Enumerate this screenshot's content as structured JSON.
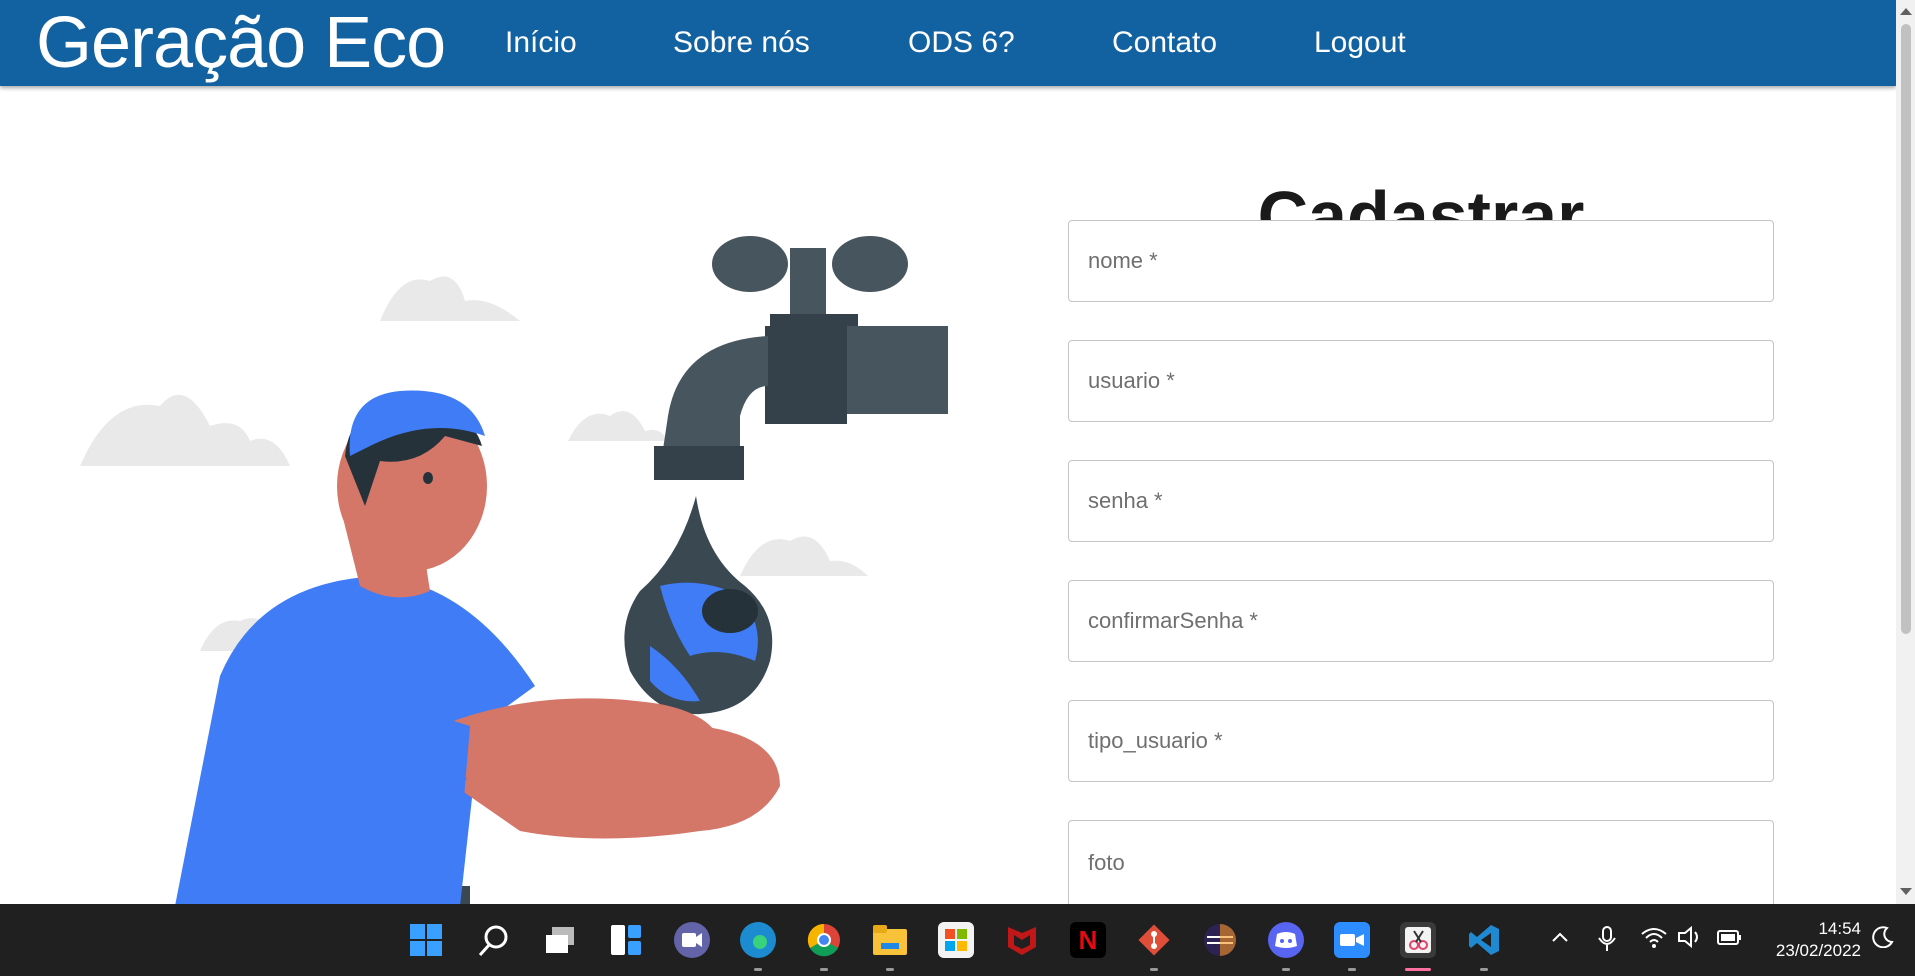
{
  "navbar": {
    "brand": "Geração Eco",
    "links": [
      "Início",
      "Sobre nós",
      "ODS 6?",
      "Contato",
      "Logout"
    ]
  },
  "form": {
    "title": "Cadastrar",
    "fields": [
      {
        "placeholder": "nome *",
        "value": ""
      },
      {
        "placeholder": "usuario *",
        "value": ""
      },
      {
        "placeholder": "senha *",
        "value": ""
      },
      {
        "placeholder": "confirmarSenha *",
        "value": ""
      },
      {
        "placeholder": "tipo_usuario *",
        "value": ""
      },
      {
        "placeholder": "foto",
        "value": ""
      }
    ]
  },
  "colors": {
    "navbar": "#1262a2",
    "shirt": "#3f7cf6",
    "skin": "#d47668",
    "faucet": "#47555f"
  },
  "taskbar": {
    "icons": [
      "windows-start-icon",
      "search-icon",
      "task-view-icon",
      "widgets-icon",
      "teams-chat-icon",
      "edge-icon",
      "chrome-icon",
      "file-explorer-icon",
      "microsoft-store-icon",
      "mcafee-icon",
      "netflix-icon",
      "git-icon",
      "eclipse-icon",
      "discord-icon",
      "zoom-icon",
      "snipping-tool-icon",
      "vscode-icon"
    ],
    "netflix_letter": "N",
    "time": "14:54",
    "date": "23/02/2022"
  }
}
